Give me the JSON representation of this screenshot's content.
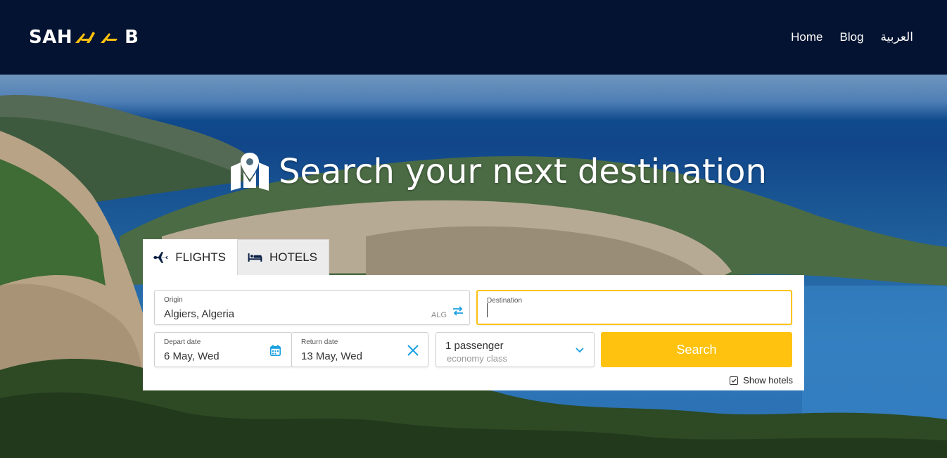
{
  "header": {
    "logo_text_left": "SAH",
    "logo_text_right": "B",
    "nav": [
      "Home",
      "Blog",
      "العربية"
    ]
  },
  "hero": {
    "headline": "Search your next destination",
    "headline_icon": "map-pin-icon"
  },
  "tabs": [
    {
      "label": "FLIGHTS",
      "icon": "airplane-icon",
      "active": true
    },
    {
      "label": "HOTELS",
      "icon": "bed-icon",
      "active": false
    }
  ],
  "search": {
    "origin_label": "Origin",
    "origin_value": "Algiers, Algeria",
    "origin_code": "ALG",
    "destination_label": "Destination",
    "destination_value": "",
    "depart_label": "Depart date",
    "depart_value": "6 May, Wed",
    "return_label": "Return date",
    "return_value": "13 May, Wed",
    "passengers": "1 passenger",
    "cabin_class": "economy class",
    "search_button": "Search",
    "show_hotels": "Show hotels"
  },
  "colors": {
    "header_bg": "#031331",
    "accent_yellow": "#ffc20e",
    "icon_blue": "#1ba0e1",
    "dark_icon": "#0a1f44"
  }
}
